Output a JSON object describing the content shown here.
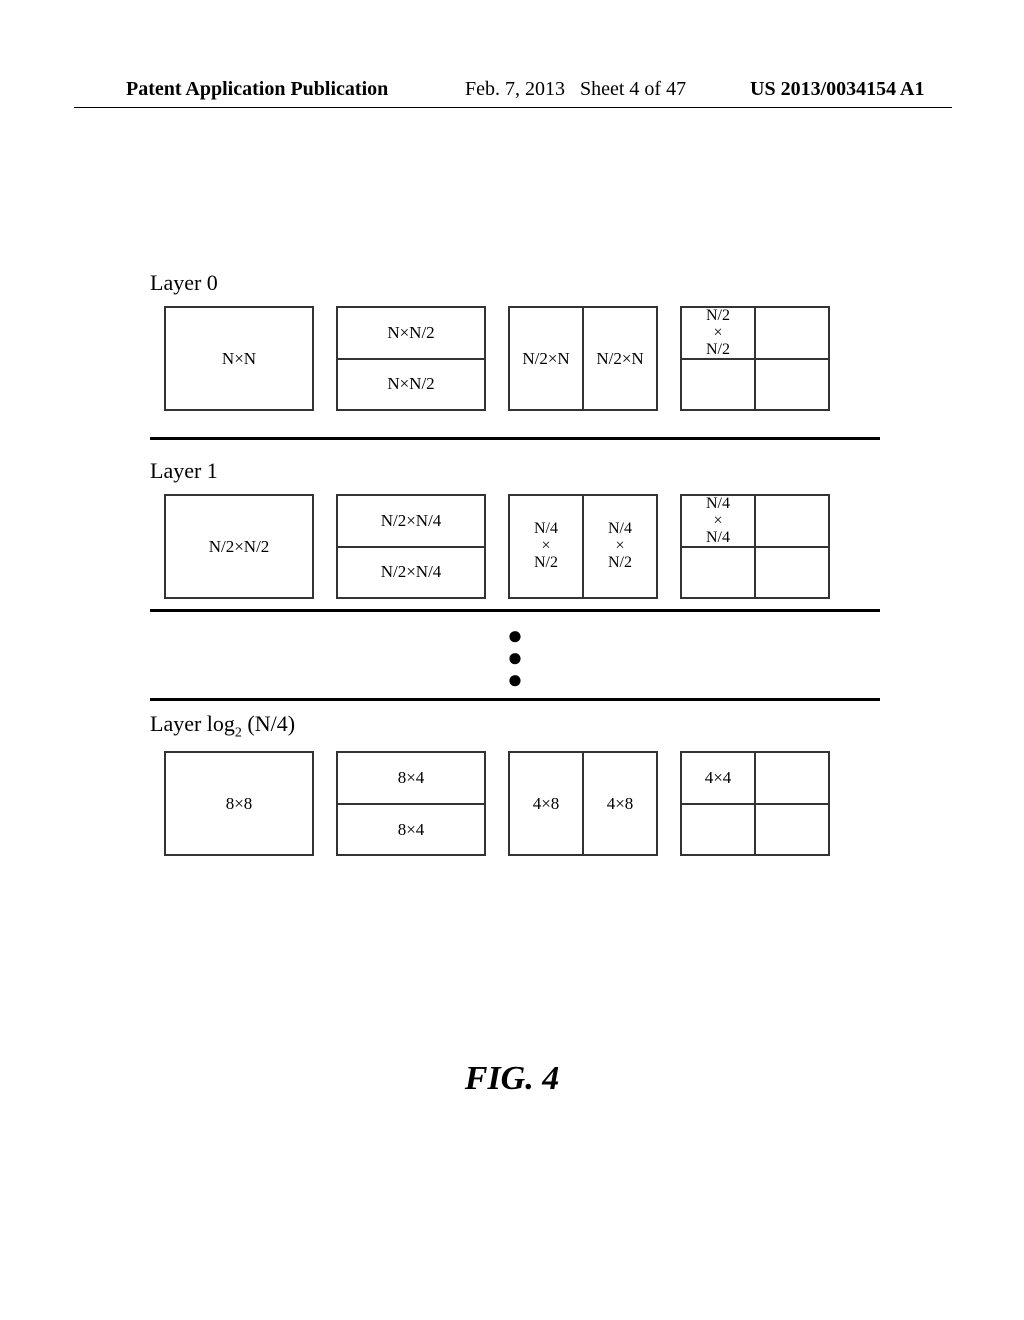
{
  "header": {
    "left": "Patent Application Publication",
    "mid_date": "Feb. 7, 2013",
    "mid_sheet": "Sheet 4 of 47",
    "right": "US 2013/0034154 A1"
  },
  "figure_caption": "FIG. 4",
  "layers": [
    {
      "label": "Layer 0",
      "blocks": {
        "full": "N×N",
        "h_top": "N×N/2",
        "h_bot": "N×N/2",
        "v_left": "N/2×N",
        "v_right": "N/2×N",
        "quad_tl": "N/2\n×\nN/2"
      }
    },
    {
      "label": "Layer 1",
      "blocks": {
        "full": "N/2×N/2",
        "h_top": "N/2×N/4",
        "h_bot": "N/2×N/4",
        "v_left": "N/4\n×\nN/2",
        "v_right": "N/4\n×\nN/2",
        "quad_tl": "N/4\n×\nN/4"
      }
    },
    {
      "label_prefix": "Layer log",
      "label_sub": "2",
      "label_suffix": " (N/4)",
      "blocks": {
        "full": "8×8",
        "h_top": "8×4",
        "h_bot": "8×4",
        "v_left": "4×8",
        "v_right": "4×8",
        "quad_tl": "4×4"
      }
    }
  ]
}
